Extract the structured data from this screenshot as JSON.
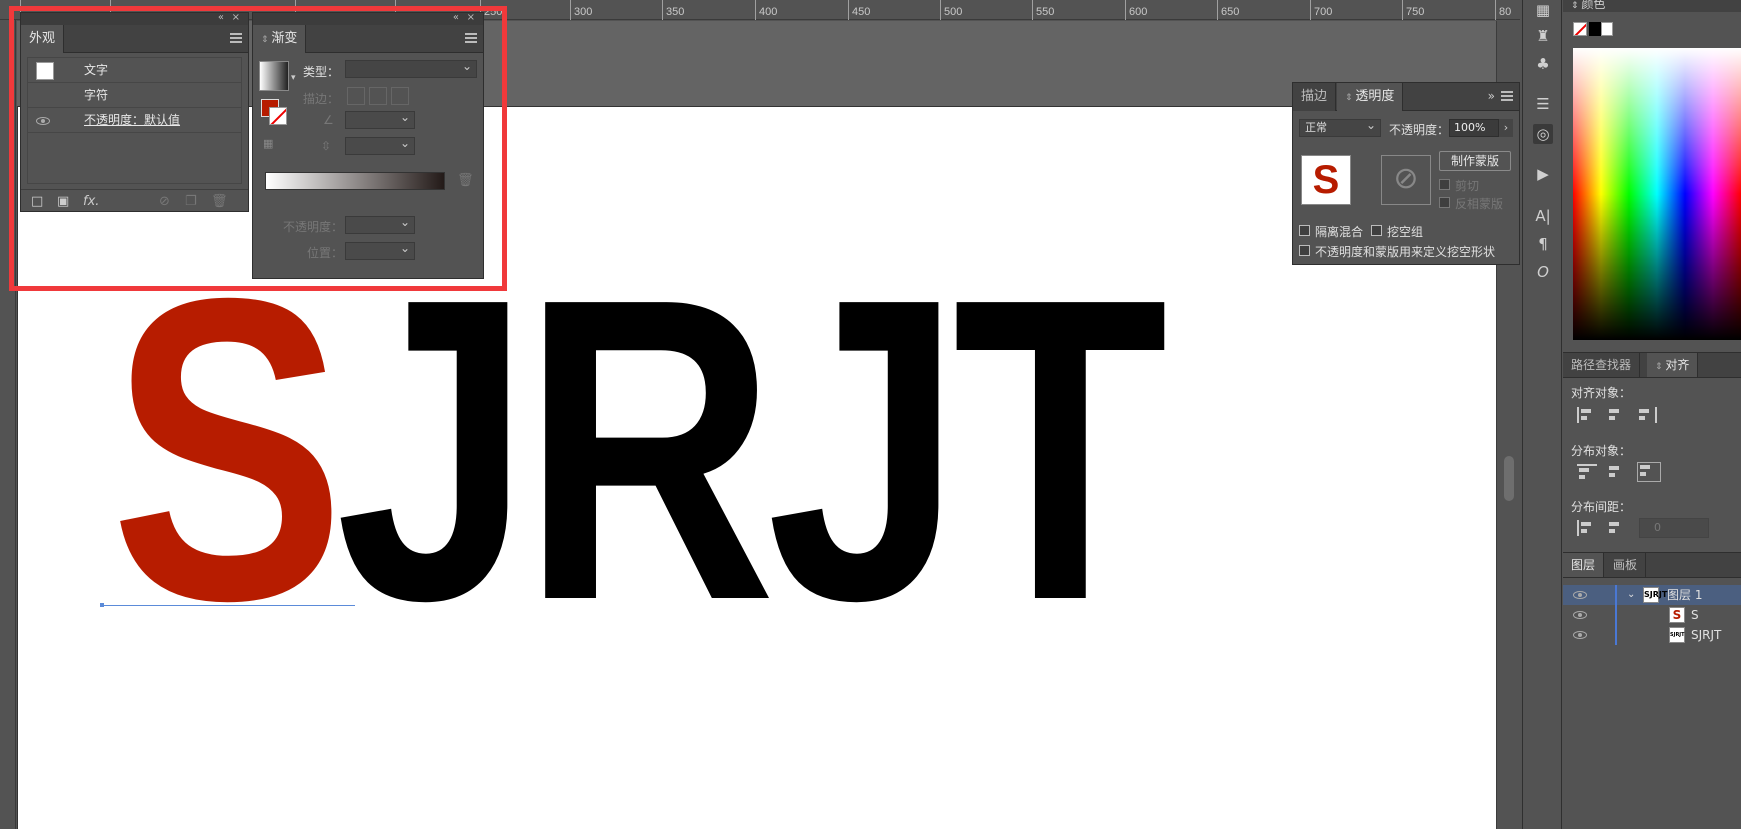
{
  "ruler": {
    "labels": [
      "250",
      "300",
      "350",
      "400",
      "450",
      "500",
      "550",
      "600",
      "650",
      "700",
      "750",
      "80"
    ]
  },
  "canvas": {
    "letter_s": "S",
    "letters_rest": "JRJT"
  },
  "appearance": {
    "tab": "外观",
    "rows": [
      {
        "label": "文字"
      },
      {
        "label": "字符"
      },
      {
        "label": "不透明度：默认值"
      }
    ],
    "fx": "fx."
  },
  "gradient": {
    "tab": "渐变",
    "type_label": "类型：",
    "stroke_label": "描边：",
    "opacity_label": "不透明度：",
    "position_label": "位置："
  },
  "transparency": {
    "tab_stroke": "描边",
    "tab_transparency": "透明度",
    "blend_mode": "正常",
    "opacity_label": "不透明度：",
    "opacity_value": "100%",
    "thumb_letter": "S",
    "make_mask": "制作蒙版",
    "clip": "剪切",
    "invert_mask": "反相蒙版",
    "isolate_blend": "隔离混合",
    "knockout_group": "挖空组",
    "opacity_mask_define": "不透明度和蒙版用来定义挖空形状"
  },
  "color_panel": {
    "tab": "颜色"
  },
  "align_panel": {
    "tab_pathfinder": "路径查找器",
    "tab_align": "对齐",
    "align_objects": "对齐对象：",
    "distribute_objects": "分布对象：",
    "distribute_spacing": "分布间距：",
    "spacing_value": "0"
  },
  "layers_panel": {
    "tab_layers": "图层",
    "tab_artboards": "画板",
    "layers": [
      {
        "name": "图层 1",
        "thumb": "SJRJT"
      },
      {
        "name": "S",
        "thumb": "S"
      },
      {
        "name": "SJRJT",
        "thumb": "SJRJT"
      }
    ]
  },
  "colors": {
    "accent_red": "#b71c00",
    "highlight": "#f0393b",
    "layer_blue": "#4a78d4"
  }
}
